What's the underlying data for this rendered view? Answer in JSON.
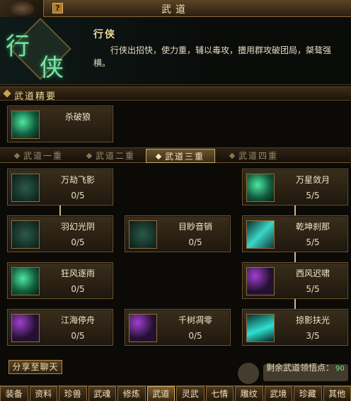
{
  "window": {
    "title": "武道",
    "help_label": "?"
  },
  "class_info": {
    "emblem_glyph_1": "行",
    "emblem_glyph_2": "侠",
    "name": "行侠",
    "description": "行侠出招快，使力重，辅以毒攻，擅用群攻破团局，桀骜强横。"
  },
  "essence_section": {
    "title": "武道精要",
    "skill": {
      "name": "杀破狼",
      "icon": "wolf-icon"
    }
  },
  "tabs": [
    "武道一重",
    "武道二重",
    "武道三重",
    "武道四重"
  ],
  "active_tab": "武道三重",
  "skills": {
    "wanjie_feiying": {
      "name": "万劫飞影",
      "count": "0/5",
      "icon": "shadow-beast-icon"
    },
    "wanxing_duoyue": {
      "name": "万星敛月",
      "count": "5/5",
      "icon": "jade-claw-icon"
    },
    "yuhuan_guangyin": {
      "name": "羽幻光阴",
      "count": "0/5",
      "icon": "feather-icon"
    },
    "mumiao_yinxiao": {
      "name": "目眇音销",
      "count": "0/5",
      "icon": "serpent-icon"
    },
    "qiankun_chana": {
      "name": "乾坤刹那",
      "count": "5/5",
      "icon": "blade-icon"
    },
    "kuangfeng_zhuyu": {
      "name": "狂风逐雨",
      "count": "0/5",
      "icon": "wind-icon"
    },
    "xifeng_chixiao": {
      "name": "西风迟啸",
      "count": "5/5",
      "icon": "purple-blade-icon"
    },
    "jianghai_tingzhou": {
      "name": "江海停舟",
      "count": "0/5",
      "icon": "boat-icon"
    },
    "qianshu_diaoling": {
      "name": "千树凋零",
      "count": "0/5",
      "icon": "dark-blade-icon"
    },
    "lveying_fuguang": {
      "name": "掠影扶光",
      "count": "3/5",
      "icon": "light-blade-icon"
    }
  },
  "footer": {
    "share_label": "分享至聊天",
    "points_label": "剩余武道领悟点：",
    "points_value": "90"
  },
  "bottom_tabs": [
    "装备",
    "资料",
    "珍兽",
    "武魂",
    "修炼",
    "武道",
    "灵武",
    "七情",
    "雕纹",
    "武境",
    "珍藏",
    "其他"
  ],
  "active_bottom_tab": "武道"
}
